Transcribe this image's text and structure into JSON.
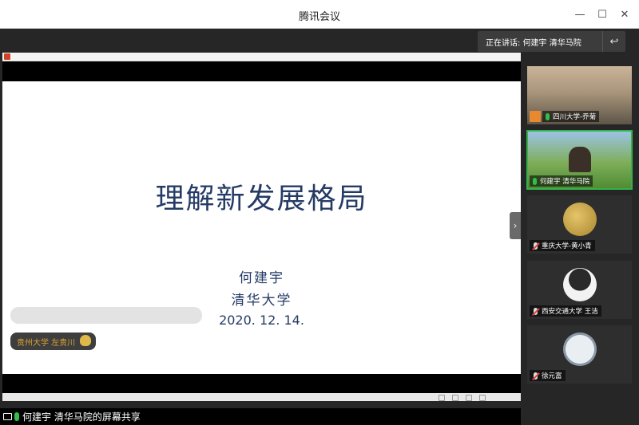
{
  "window": {
    "title": "腾讯会议",
    "min_symbol": "—",
    "max_symbol": "☐",
    "close_symbol": "✕"
  },
  "speaking": {
    "text": "正在讲话: 何建宇 清华马院",
    "back_symbol": "↩"
  },
  "slide": {
    "title": "理解新发展格局",
    "author": "何建宇",
    "org": "清华大学",
    "date": "2020. 12. 14."
  },
  "speaker_chip": {
    "text": "贵州大学 左贵川"
  },
  "share_bar": {
    "text": "何建宇 清华马院的屏幕共享"
  },
  "participants": [
    {
      "name": "四川大学-乔菊",
      "mic": "on"
    },
    {
      "name": "何建宇 清华马院",
      "mic": "on",
      "active": true
    },
    {
      "name": "重庆大学-黄小青",
      "mic": "off"
    },
    {
      "name": "西安交通大学  王洁",
      "mic": "off"
    },
    {
      "name": "徐元富",
      "mic": "off"
    }
  ],
  "colors": {
    "accent_green": "#36b24a",
    "slide_text": "#253b66",
    "chip_text": "#d7a234"
  },
  "icons": [
    "screen-share-icon",
    "mic-icon",
    "mic-muted-icon",
    "person-icon",
    "back-icon",
    "chevron-right-icon",
    "raise-hand-icon"
  ]
}
